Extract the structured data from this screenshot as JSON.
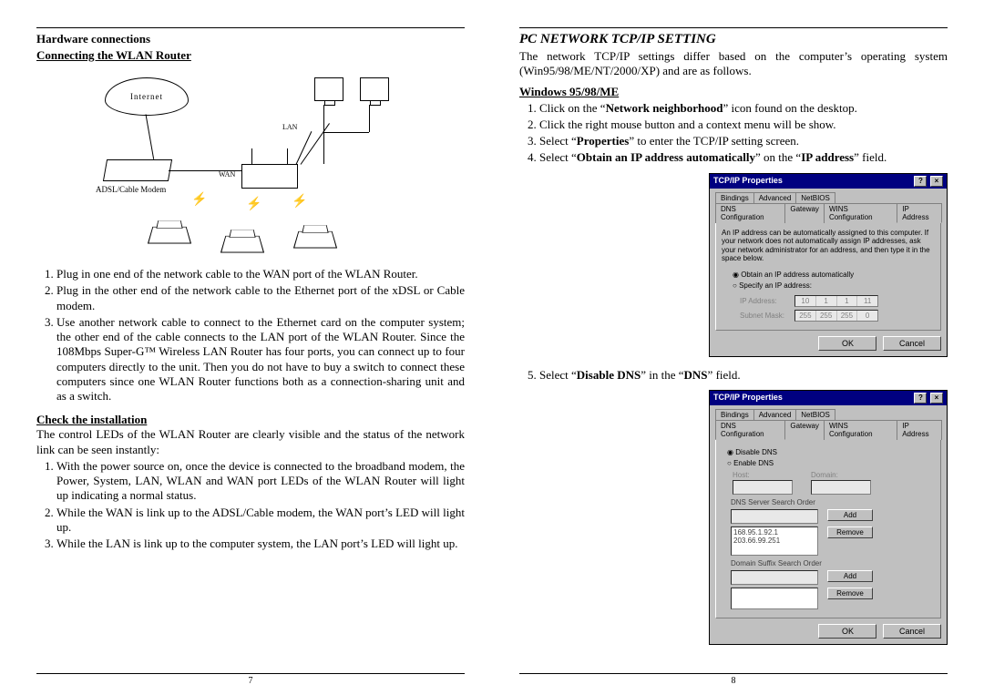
{
  "left": {
    "page_number": "7",
    "h1": "Hardware connections",
    "h2": "Connecting the WLAN Router",
    "figure": {
      "internet": "Internet",
      "modem_label": "ADSL/Cable Modem",
      "lan": "LAN",
      "wan": "WAN"
    },
    "steps_a": [
      "Plug in one end of the network cable to the WAN port of the WLAN Router.",
      "Plug in the other end of the network cable to the Ethernet port of the xDSL or Cable modem.",
      "Use another network cable to connect to the Ethernet card on the computer system; the other end of the cable connects to the LAN port of the WLAN Router. Since the 108Mbps Super-G™ Wireless LAN Router has four ports, you can connect up to four computers directly to the unit. Then you do not have to buy a switch to connect these computers since one WLAN Router functions both as a connection-sharing unit and as a switch."
    ],
    "h3": "Check the installation",
    "check_intro": "The control LEDs of the WLAN Router are clearly visible and the status of the network link can be seen instantly:",
    "steps_b": [
      "With the power source on, once the device is connected to the broadband modem, the Power, System, LAN, WLAN and WAN port LEDs of the WLAN Router will light up indicating a normal status.",
      "While the WAN is link up to the ADSL/Cable modem, the WAN port’s LED will light up.",
      "While the LAN is link up to the computer system, the LAN port’s LED will light up."
    ]
  },
  "right": {
    "page_number": "8",
    "title": "PC NETWORK TCP/IP SETTING",
    "intro": "The network TCP/IP settings differ based on the computer’s operating system (Win95/98/ME/NT/2000/XP) and are as follows.",
    "h_os": "Windows 95/98/ME",
    "steps": [
      {
        "pre": "Click on the “",
        "bold": "Network neighborhood",
        "post": "” icon found on the desktop."
      },
      {
        "pre": "Click the right mouse button and a context menu will be show.",
        "bold": "",
        "post": ""
      },
      {
        "pre": "Select “",
        "bold": "Properties",
        "post": "” to enter the TCP/IP setting screen."
      },
      {
        "pre": "Select “",
        "bold": "Obtain an IP address automatically",
        "post": "” on the “IP address” field.",
        "bold2": "IP address"
      }
    ],
    "step5": {
      "pre": "Select “",
      "bold": "Disable DNS",
      "post": "” in the “",
      "bold2": "DNS",
      "post2": "” field."
    },
    "dialog1": {
      "title": "TCP/IP Properties",
      "tabs_row1": [
        "Bindings",
        "Advanced",
        "NetBIOS"
      ],
      "tabs_row2": [
        "DNS Configuration",
        "Gateway",
        "WINS Configuration",
        "IP Address"
      ],
      "active_tab": "IP Address",
      "desc": "An IP address can be automatically assigned to this computer. If your network does not automatically assign IP addresses, ask your network administrator for an address, and then type it in the space below.",
      "radio1": "Obtain an IP address automatically",
      "radio2": "Specify an IP address:",
      "ip_label": "IP Address:",
      "ip_val": [
        "10",
        "1",
        "1",
        "11"
      ],
      "mask_label": "Subnet Mask:",
      "mask_val": [
        "255",
        "255",
        "255",
        "0"
      ],
      "ok": "OK",
      "cancel": "Cancel"
    },
    "dialog2": {
      "title": "TCP/IP Properties",
      "tabs_row1": [
        "Bindings",
        "Advanced",
        "NetBIOS"
      ],
      "tabs_row2": [
        "DNS Configuration",
        "Gateway",
        "WINS Configuration",
        "IP Address"
      ],
      "active_tab": "DNS Configuration",
      "radio1": "Disable DNS",
      "radio2": "Enable DNS",
      "host_label": "Host:",
      "domain_label": "Domain:",
      "order_label": "DNS Server Search Order",
      "list_items": "168.95.1.92.1\n203.66.99.251",
      "suffix_label": "Domain Suffix Search Order",
      "add": "Add",
      "remove": "Remove",
      "ok": "OK",
      "cancel": "Cancel"
    }
  }
}
